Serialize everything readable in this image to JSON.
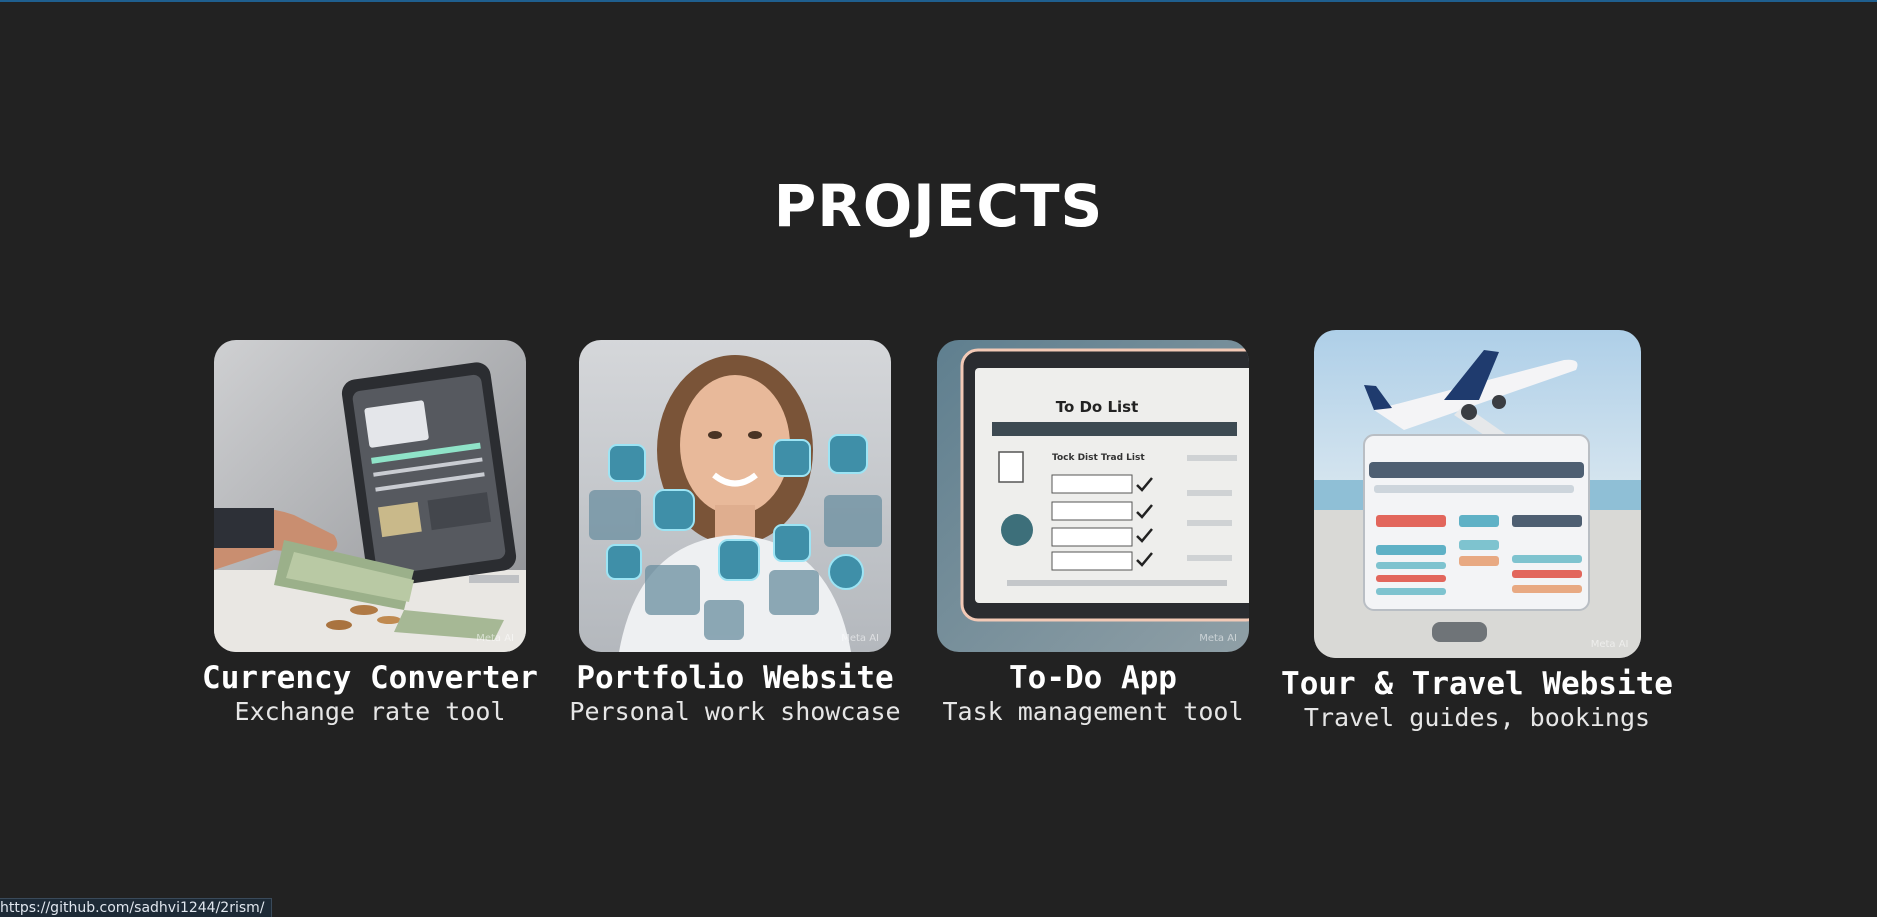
{
  "section": {
    "title": "PROJECTS"
  },
  "projects": [
    {
      "name": "Currency Converter",
      "description": "Exchange rate tool",
      "image_alt": "Hand holding dollar bills next to a tablet showing a currency app",
      "watermark": "Meta AI"
    },
    {
      "name": "Portfolio Website",
      "description": "Personal work showcase",
      "image_alt": "Smiling woman surrounded by floating app icons",
      "watermark": "Meta AI"
    },
    {
      "name": "To-Do App",
      "description": "Task management tool",
      "image_alt": "Monitor displaying a To Do List app",
      "watermark": "Meta AI",
      "screen_title": "To Do List",
      "screen_subtitle": "Tock Dist Trad List"
    },
    {
      "name": "Tour & Travel Website",
      "description": "Travel guides, bookings",
      "image_alt": "Airplane above a travel booking app interface",
      "watermark": "Meta AI"
    }
  ],
  "status_bar": {
    "url": "https://github.com/sadhvi1244/2rism/"
  },
  "colors": {
    "background": "#222222",
    "accent_line": "#1f5f8f",
    "text_primary": "#ffffff"
  }
}
